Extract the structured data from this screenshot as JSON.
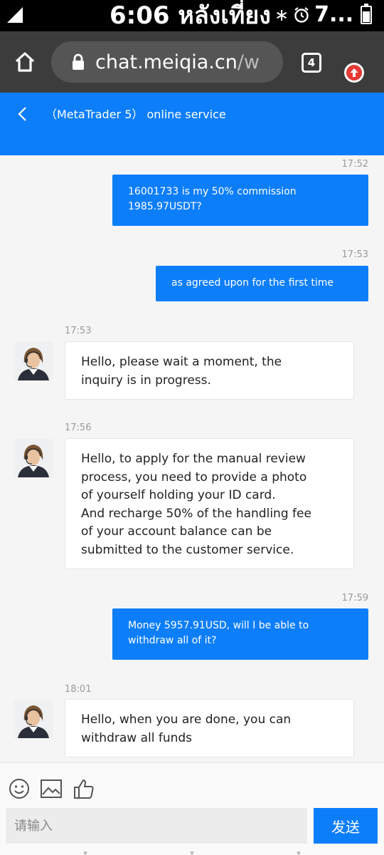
{
  "status_bar": {
    "time": "6:06 หลังเที่ยง",
    "bluetooth_glyph": "∗",
    "battery_text": "7..."
  },
  "browser": {
    "url_main": "chat.meiqia.cn",
    "url_rest": "/w",
    "tab_count": "4"
  },
  "header": {
    "title": "（MetaTrader 5） online service"
  },
  "messages": [
    {
      "direction": "out",
      "time": "17:52",
      "text": "16001733 is my 50% commission\n1985.97USDT?"
    },
    {
      "direction": "out",
      "time": "17:53",
      "text": "as agreed upon for the first time"
    },
    {
      "direction": "in",
      "time": "17:53",
      "text": "Hello, please wait a moment, the\ninquiry is in progress."
    },
    {
      "direction": "in",
      "time": "17:56",
      "text": "Hello, to apply for the manual review\nprocess, you need to provide a photo\nof yourself holding your ID card.\nAnd recharge 50% of the handling fee\nof your account balance can be\nsubmitted to the customer service."
    },
    {
      "direction": "out",
      "time": "17:59",
      "text": "Money 5957.91USD, will I be able to\nwithdraw all of it?"
    },
    {
      "direction": "in",
      "time": "18:01",
      "text": "Hello, when you are done, you can\nwithdraw all funds"
    }
  ],
  "input_bar": {
    "placeholder": "请输入",
    "send_label": "发送"
  },
  "colors": {
    "accent": "#0d7efa",
    "status_bar_bg": "#000000",
    "browser_bar_bg": "#3c3c3c",
    "chat_bg": "#f5f5f5"
  },
  "icons": {
    "signal": "signal-icon",
    "alarm": "alarm-icon",
    "battery": "battery-icon",
    "home": "home-icon",
    "lock": "lock-icon",
    "tabs": "tabs-icon",
    "extension": "upload-icon",
    "back": "chevron-left-icon",
    "emoji": "emoji-icon",
    "image": "image-icon",
    "like": "thumbs-up-icon",
    "agent_avatar": "agent-avatar"
  }
}
